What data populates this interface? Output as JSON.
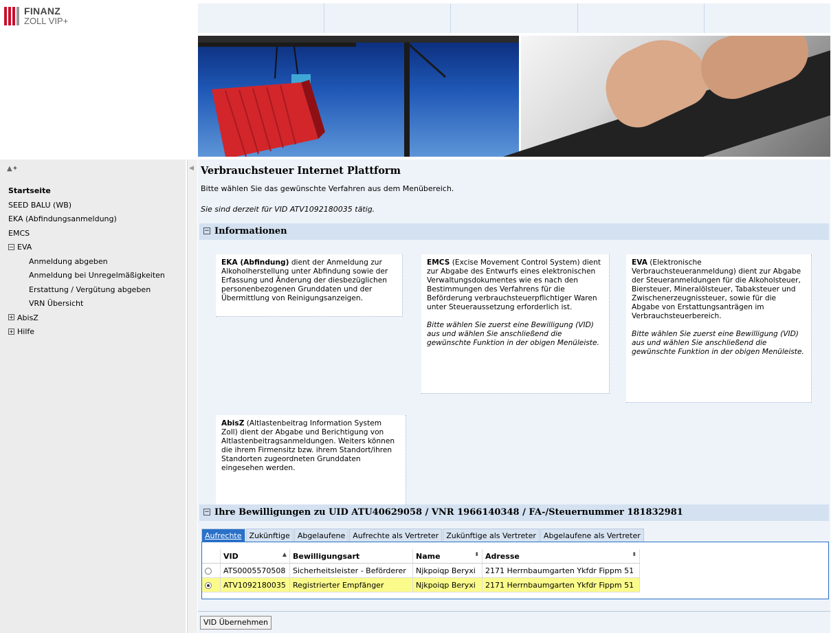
{
  "brand": {
    "logo_top": "FINANZ",
    "logo_bottom": "ZOLL VIP+",
    "bar_colors": [
      "#c8102e",
      "#c8102e",
      "#c8102e",
      "#9a9a9a"
    ]
  },
  "icons": {
    "sidebar_tools": "▲✦",
    "collapse": "◀",
    "toggle_expanded": "−",
    "toggle_collapsed": "+",
    "sort_asc": "▲",
    "sort_both": "⬍"
  },
  "sidebar": {
    "items": [
      {
        "label": "Startseite",
        "level": 0,
        "bold": true
      },
      {
        "label": "SEED BALU (WB)",
        "level": 0
      },
      {
        "label": "EKA (Abfindungsanmeldung)",
        "level": 0
      },
      {
        "label": "EMCS",
        "level": 0
      },
      {
        "label": "EVA",
        "level": 0,
        "toggle": "expanded"
      },
      {
        "label": "Anmeldung abgeben",
        "level": 1
      },
      {
        "label": "Anmeldung bei Unregelmäßigkeiten",
        "level": 1
      },
      {
        "label": "Erstattung / Vergütung abgeben",
        "level": 1
      },
      {
        "label": "VRN Übersicht",
        "level": 1
      },
      {
        "label": "AbisZ",
        "level": 0,
        "toggle": "collapsed"
      },
      {
        "label": "Hilfe",
        "level": 0,
        "toggle": "collapsed"
      }
    ]
  },
  "main": {
    "title": "Verbrauchsteuer Internet Plattform",
    "intro": "Bitte wählen Sie das gewünschte Verfahren aus dem Menübereich.",
    "status": "Sie sind derzeit für VID ATV1092180035 tätig.",
    "info_section": "Informationen",
    "cards": {
      "eka": {
        "head": "EKA (Abfindung)",
        "text": " dient der Anmeldung zur Alkoholherstellung unter Abfindung sowie der Erfassung und Änderung der diesbezüglichen personenbezogenen Grunddaten und der Übermittlung von Reinigungsanzeigen."
      },
      "emcs": {
        "head": "EMCS",
        "text": " (Excise Movement Control System) dient zur Abgabe des Entwurfs eines elektronischen Verwaltungsdokumentes wie es nach den Bestimmungen des Verfahrens für die Beförderung verbrauchsteuerpflichtiger Waren unter Steueraussetzung erforderlich ist.",
        "note": "Bitte wählen Sie zuerst eine Bewilligung (VID) aus und wählen Sie anschließend die gewünschte Funktion in der obigen Menüleiste."
      },
      "eva": {
        "head": "EVA",
        "text": " (Elektronische Verbrauchsteueranmeldung) dient zur Abgabe der Steueranmeldungen für die Alkoholsteuer, Biersteuer, Mineralölsteuer, Tabaksteuer und Zwischenerzeugnissteuer, sowie für die Abgabe von Erstattungsanträgen im Verbrauchsteuerbereich.",
        "note": "Bitte wählen Sie zuerst eine Bewilligung (VID) aus und wählen Sie anschließend die gewünschte Funktion in der obigen Menüleiste."
      },
      "abisz": {
        "head": "AbisZ",
        "text": " (Altlastenbeitrag Information System Zoll) dient der Abgabe und Berichtigung von Altlastenbeitragsanmeldungen. Weiters können die ihrem Firmensitz bzw. ihrem Standort/ihren Standorten zugeordneten Grunddaten eingesehen werden."
      }
    },
    "permissions_section": "Ihre Bewilligungen zu UID ATU40629058 / VNR 1966140348 / FA-/Steuernummer 181832981",
    "tabs": [
      "Aufrechte",
      "Zukünftige",
      "Abgelaufene",
      "Aufrechte als Vertreter",
      "Zukünftige als Vertreter",
      "Abgelaufene als Vertreter"
    ],
    "active_tab": 0,
    "table": {
      "columns": [
        "VID",
        "Bewilligungsart",
        "Name",
        "Adresse"
      ],
      "rows": [
        {
          "vid": "ATS0005570508",
          "art": "Sicherheitsleister - Beförderer",
          "name": "Njkpoiqp Beryxi",
          "addr": "2171 Herrnbaumgarten Ykfdr Fippm 51",
          "selected": false
        },
        {
          "vid": "ATV1092180035",
          "art": "Registrierter Empfänger",
          "name": "Njkpoiqp Beryxi",
          "addr": "2171 Herrnbaumgarten Ykfdr Fippm 51",
          "selected": true
        }
      ]
    },
    "button": "VID Übernehmen"
  }
}
